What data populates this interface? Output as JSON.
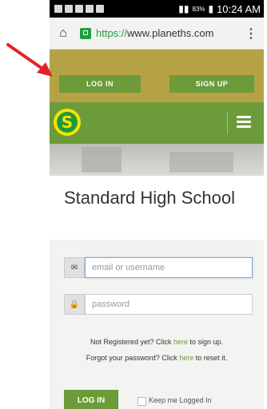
{
  "browser": {
    "url_scheme": "https://",
    "url_host": "www.planeths.com",
    "time": "10:24 AM",
    "battery": "83%"
  },
  "topnav": {
    "login_label": "LOG IN",
    "signup_label": "SIGN UP"
  },
  "brand": {
    "logo_letter": "S"
  },
  "page": {
    "title": "Standard High School"
  },
  "form": {
    "email_placeholder": "email or username",
    "password_placeholder": "password",
    "not_registered_prefix": "Not Registered yet? Click ",
    "not_registered_link": "here",
    "not_registered_suffix": " to sign up.",
    "forgot_prefix": "Forgot your password? Click ",
    "forgot_link": "here",
    "forgot_suffix": " to reset it.",
    "login_button": "LOG IN",
    "keep_logged_in": "Keep me Logged In"
  },
  "colors": {
    "nav_bg": "#b5a244",
    "brand_green": "#6c9b3a",
    "link_green": "#6c9b3a",
    "annotation_red": "#e0242b"
  }
}
